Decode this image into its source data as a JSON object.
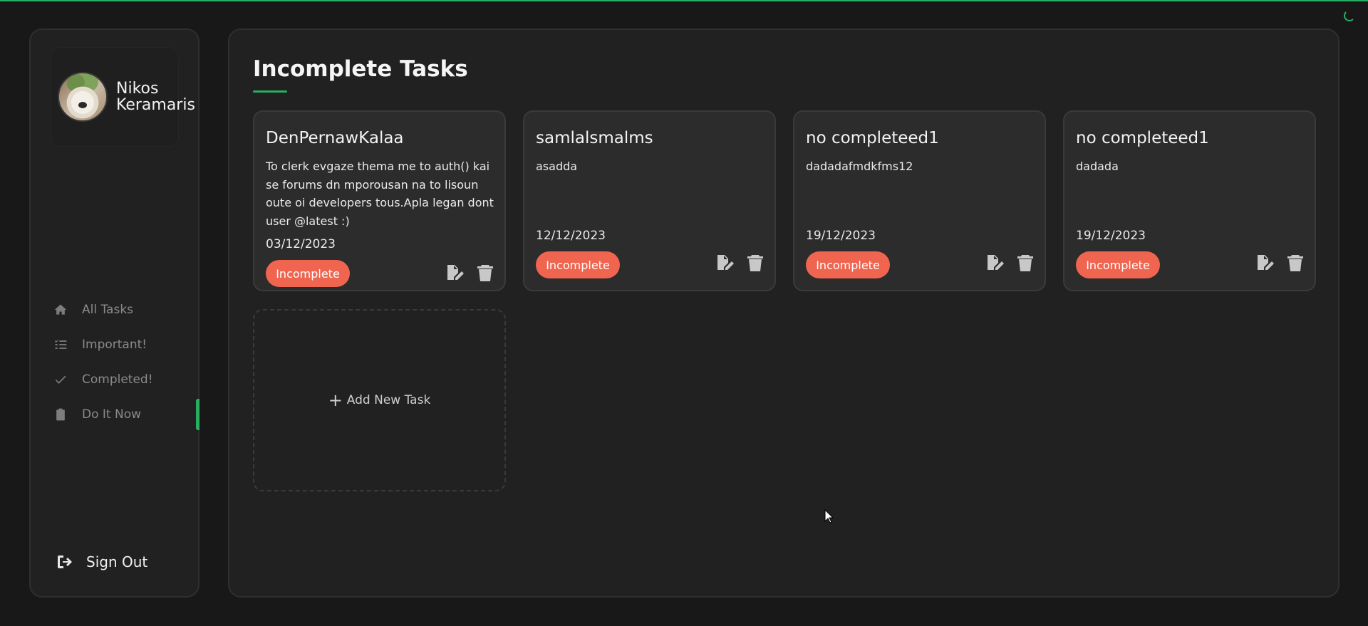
{
  "user": {
    "name": "Nikos Keramaris"
  },
  "nav": {
    "items": [
      {
        "label": "All Tasks",
        "icon": "home-icon"
      },
      {
        "label": "Important!",
        "icon": "list-check-icon"
      },
      {
        "label": "Completed!",
        "icon": "check-icon"
      },
      {
        "label": "Do It Now",
        "icon": "clipboard-icon"
      }
    ],
    "active": "Do It Now",
    "sign_out": "Sign Out"
  },
  "main": {
    "title": "Incomplete Tasks",
    "tasks": [
      {
        "title": "DenPernawKalaa",
        "description": "To clerk evgaze thema me to auth() kai se forums dn mporousan na to lisoun oute oi developers tous.Apla legan dont user @latest :)",
        "date": "03/12/2023",
        "status": "Incomplete"
      },
      {
        "title": "samlalsmalms",
        "description": "asadda",
        "date": "12/12/2023",
        "status": "Incomplete"
      },
      {
        "title": "no completeed1",
        "description": "dadadafmdkfms12",
        "date": "19/12/2023",
        "status": "Incomplete"
      },
      {
        "title": "no completeed1",
        "description": "dadada",
        "date": "19/12/2023",
        "status": "Incomplete"
      }
    ],
    "add_task_label": "Add New Task"
  },
  "colors": {
    "accent": "#27ae60",
    "status_incomplete": "#f06550"
  }
}
